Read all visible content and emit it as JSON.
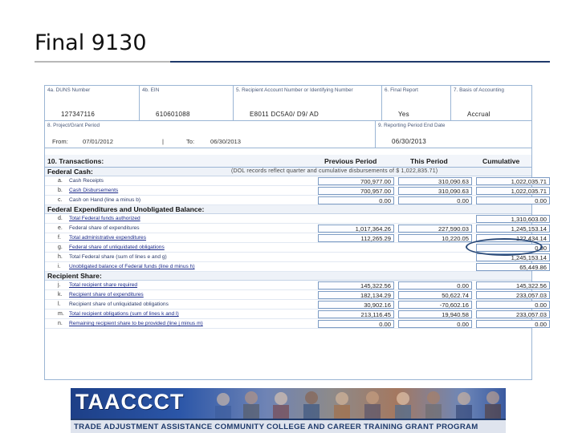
{
  "slide": {
    "title": "Final 9130"
  },
  "header": {
    "row1": [
      {
        "label": "4a. DUNS Number",
        "value": "127347116"
      },
      {
        "label": "4b. EIN",
        "value": "610601088"
      },
      {
        "label": "5. Recipient Account Number or Identifying Number",
        "value": "E8011 DC5A0/ D9/ AD"
      },
      {
        "label": "6. Final Report",
        "value": "Yes"
      },
      {
        "label": "7. Basis of Accounting",
        "value": "Accrual"
      }
    ],
    "project_period": {
      "label": "8. Project/Grant Period",
      "from_label": "From:",
      "from": "07/01/2012",
      "to_label": "To:",
      "to": "06/30/2013"
    },
    "reporting_period": {
      "label": "9. Reporting Period End Date",
      "value": "06/30/2013"
    }
  },
  "transactions": {
    "heading": "10.   Transactions:",
    "col_prev": "Previous Period",
    "col_this": "This Period",
    "col_cum": "Cumulative"
  },
  "federal_cash": {
    "label": "Federal Cash:",
    "note": "(DOL records reflect quarter and cumulative disbursements of $ 1,022,835.71)",
    "rows": [
      {
        "letter": "a.",
        "desc": "Cash Receipts",
        "prev": "700,977.00",
        "this": "310,090.63",
        "cum": "1,022,035.71"
      },
      {
        "letter": "b.",
        "desc": "Cash Disbursements",
        "prev": "700,957.00",
        "this": "310,090.63",
        "cum": "1,022,035.71"
      },
      {
        "letter": "c.",
        "desc": "Cash on Hand (line a minus b)",
        "prev": "0.00",
        "this": "0.00",
        "cum": "0.00"
      }
    ]
  },
  "federal_exp": {
    "label": "Federal Expenditures and Unobligated Balance:",
    "rows": [
      {
        "letter": "d.",
        "desc": "Total Federal funds authorized",
        "prev": "",
        "this": "",
        "cum": "1,310,603.00"
      },
      {
        "letter": "e.",
        "desc": "Federal share of expenditures",
        "prev": "1,017,364.26",
        "this": "227,590.03",
        "cum": "1,245,153.14"
      },
      {
        "letter": "f.",
        "desc": "Total administrative expenditures",
        "prev": "112,265.29",
        "this": "10,220.05",
        "cum": "122,434.14"
      },
      {
        "letter": "g.",
        "desc": "Federal share of unliquidated obligations",
        "prev": "",
        "this": "",
        "cum": "0.00"
      },
      {
        "letter": "h.",
        "desc": "Total Federal share (sum of lines e and g)",
        "prev": "",
        "this": "",
        "cum": "1,245,153.14"
      },
      {
        "letter": "i.",
        "desc": "Unobligated balance of Federal funds (line d minus h)",
        "prev": "",
        "this": "",
        "cum": "65,449.86"
      }
    ]
  },
  "recipient_share": {
    "label": "Recipient Share:",
    "rows": [
      {
        "letter": "j.",
        "desc": "Total recipient share required",
        "prev": "145,322.56",
        "this": "0.00",
        "cum": "145,322.56"
      },
      {
        "letter": "k.",
        "desc": "Recipient share of expenditures",
        "prev": "182,134.29",
        "this": "50,622.74",
        "cum": "233,057.03"
      },
      {
        "letter": "l.",
        "desc": "Recipient share of unliquidated obligations",
        "prev": "30,902.16",
        "this": "-70,602.16",
        "cum": "0.00"
      },
      {
        "letter": "m.",
        "desc": "Total recipient obligations (sum of lines k and l)",
        "prev": "213,116.45",
        "this": "19,940.58",
        "cum": "233,057.03"
      },
      {
        "letter": "n.",
        "desc": "Remaining recipient share to be provided (line j minus m)",
        "prev": "0.00",
        "this": "0.00",
        "cum": "0.00"
      }
    ]
  },
  "banner": {
    "logo": "TAACCCT",
    "subtitle": "TRADE ADJUSTMENT ASSISTANCE COMMUNITY COLLEGE AND CAREER TRAINING GRANT PROGRAM"
  },
  "colors": {
    "accent": "#1f3a6b",
    "form_border": "#9bb5d4",
    "highlight": "#2b4a78"
  }
}
